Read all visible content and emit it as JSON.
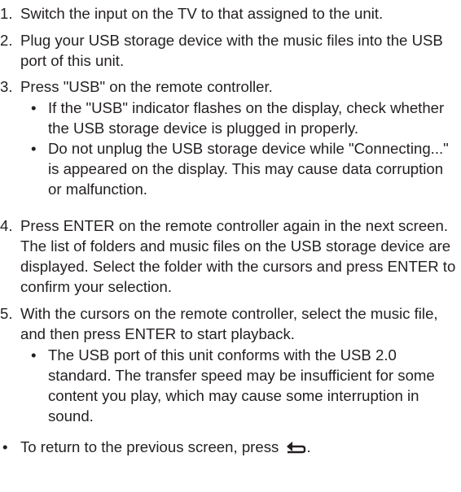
{
  "steps": [
    {
      "num": "1.",
      "text": "Switch the input on the TV to that assigned to the unit."
    },
    {
      "num": "2.",
      "text": "Plug your USB storage device with the music files into the USB port of this unit."
    },
    {
      "num": "3.",
      "text": "Press \"USB\" on the remote controller.",
      "subs": [
        "If the \"USB\" indicator flashes on the display, check whether the USB storage device is plugged in properly.",
        "Do not unplug the USB storage device while \"Connecting...\" is appeared on the display. This may cause data corruption or malfunction."
      ]
    },
    {
      "num": "4.",
      "text": "Press ENTER on the remote controller again in the next screen. The list of folders and music files on the USB storage device are displayed. Select the folder with the cursors and press ENTER to confirm your selection."
    },
    {
      "num": "5.",
      "text": "With the cursors on the remote controller, select the music file, and then press ENTER to start playback.",
      "subs": [
        "The USB port of this unit conforms with the USB 2.0 standard. The transfer speed may be insufficient for some content you play, which may cause some interruption in sound."
      ]
    }
  ],
  "note": {
    "text": "To return to the previous screen, press",
    "icon": "return-arrow-icon",
    "suffix": "."
  }
}
